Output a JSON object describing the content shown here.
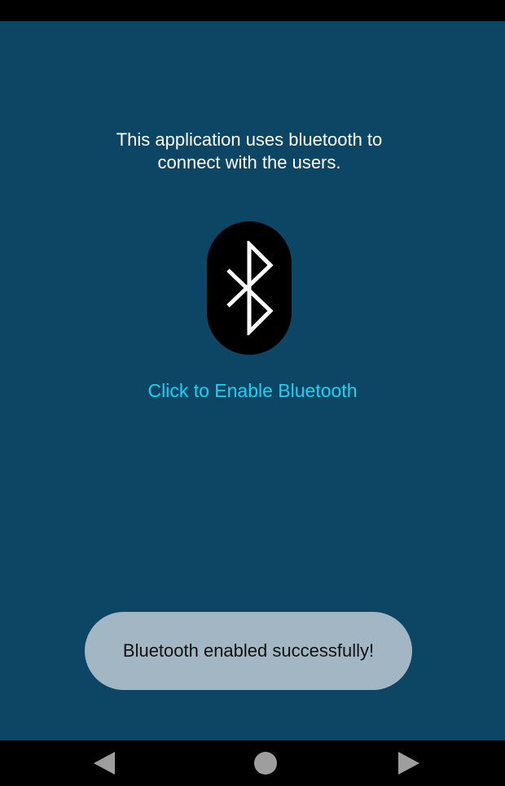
{
  "intro": {
    "line1": "This application uses bluetooth to",
    "line2": "connect with the users."
  },
  "bluetooth_button": {
    "icon": "bluetooth-icon"
  },
  "enable_link": {
    "label": "Click to Enable Bluetooth"
  },
  "toast": {
    "message": "Bluetooth enabled successfully!"
  },
  "nav": {
    "back_icon": "triangle-left-icon",
    "home_icon": "circle-icon",
    "recents_icon": "triangle-right-icon"
  },
  "colors": {
    "background": "#0d4564",
    "accent": "#18d2f5",
    "toast_bg": "#a3b6c3",
    "button_bg": "#000000"
  }
}
